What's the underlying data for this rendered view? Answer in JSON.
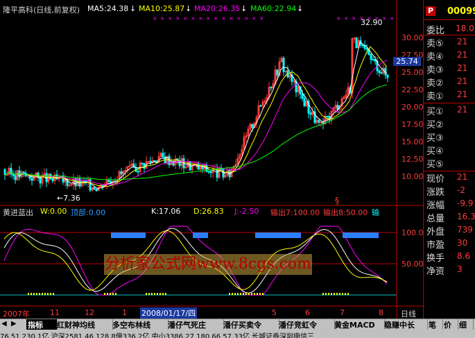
{
  "chart_header": {
    "title": "隆平高科(日线,前复权)",
    "ma5": "MA5:24.38",
    "ma10": "MA10:25.87",
    "ma20": "MA20:26.35",
    "ma60": "MA60:22.94",
    "arrow": "↓"
  },
  "indicator_header": {
    "name": "黄进蓝出",
    "w": "W:0.00",
    "top": "顶部:0.00",
    "k": "K:17.06",
    "d": "D:26.83",
    "j": "J:-2.50",
    "out1": "输出7:100.00",
    "out2": "输出8:50.00",
    "out3": "输"
  },
  "price_axis": {
    "ticks": [
      "30.00",
      "27.50",
      "25.00",
      "22.50",
      "20.00",
      "17.50",
      "15.00",
      "12.50",
      "10.00"
    ],
    "current": "25.74",
    "high_label": "32.90",
    "low_label": "←7.36",
    "event_mark": "§"
  },
  "indicator_axis": {
    "ticks": [
      "100.0",
      "50.00"
    ]
  },
  "x_axis": {
    "labels": [
      "2007年",
      "11",
      "12",
      "1",
      "2008/01/17/四",
      "5",
      "6",
      "7",
      "8"
    ],
    "period": "日线"
  },
  "watermark": "分析家公式网www.8cgs.com",
  "quote_panel": {
    "badge": "P",
    "code": "00099",
    "weibi_label": "委比",
    "weibi_value": "18.0",
    "asks": [
      {
        "label": "卖⑤",
        "value": "21"
      },
      {
        "label": "卖④",
        "value": "21"
      },
      {
        "label": "卖③",
        "value": "21"
      },
      {
        "label": "卖②",
        "value": "21"
      },
      {
        "label": "卖①",
        "value": "21"
      }
    ],
    "bids": [
      {
        "label": "买①",
        "value": "21"
      },
      {
        "label": "买②",
        "value": ""
      },
      {
        "label": "买③",
        "value": ""
      },
      {
        "label": "买④",
        "value": ""
      },
      {
        "label": "买⑤",
        "value": ""
      }
    ],
    "stats": [
      {
        "label": "现价",
        "value": "21"
      },
      {
        "label": "涨跌",
        "value": "-2"
      },
      {
        "label": "涨幅",
        "value": "-9.9"
      },
      {
        "label": "总量",
        "value": "16.3"
      },
      {
        "label": "外盘",
        "value": "739"
      },
      {
        "label": "市盈",
        "value": "30"
      },
      {
        "label": "换手",
        "value": "8.6"
      },
      {
        "label": "净资",
        "value": "3"
      }
    ]
  },
  "tabs": [
    "指标",
    "红财神均线",
    "多空布林线",
    "潘仔气死庄",
    "潘仔买卖令",
    "潘仔竞虹令",
    "黄金MACD",
    "稳赚中长"
  ],
  "tab_right": [
    "笔",
    "价",
    "细"
  ],
  "status_text": "76.51 230.1亿  沪深2581.46 128.8億336.2亿  中小3386.27 180.66 57.33亿        长城证券深圳申信三",
  "colors": {
    "up": "#ff3b3b",
    "down": "#00ffff",
    "ma5": "#ffffff",
    "ma10": "#ffff00",
    "ma20": "#ff00ff",
    "ma60": "#00ff00",
    "bluebar": "#2c7fff"
  }
}
